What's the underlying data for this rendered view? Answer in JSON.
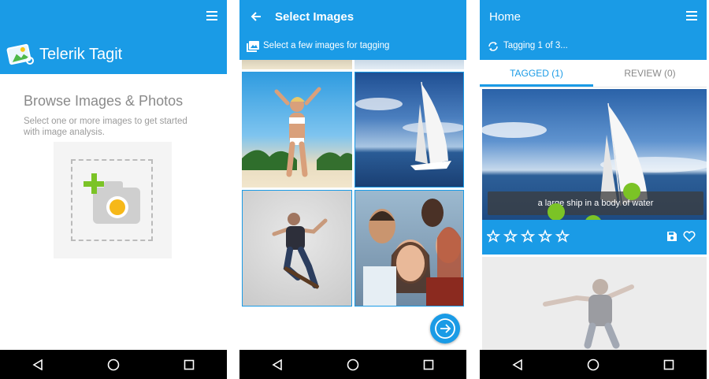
{
  "screen1": {
    "app_title": "Telerik Tagit",
    "browse_title": "Browse Images & Photos",
    "browse_description": "Select one or more images to get started with image analysis."
  },
  "screen2": {
    "title": "Select Images",
    "subtitle": "Select a few images for tagging"
  },
  "screen3": {
    "title": "Home",
    "status": "Tagging 1 of 3...",
    "tabs": [
      {
        "label": "TAGGED (1)",
        "selected": true
      },
      {
        "label": "REVIEW (0)",
        "selected": false
      }
    ],
    "caption": "a large ship in a body of water",
    "rating": 0,
    "rating_max": 5
  },
  "navbar": [
    "back-icon",
    "home-icon",
    "recents-icon"
  ],
  "colors": {
    "accent": "#1a9be6",
    "tag_dot": "#7bc326",
    "nav": "#000000"
  }
}
